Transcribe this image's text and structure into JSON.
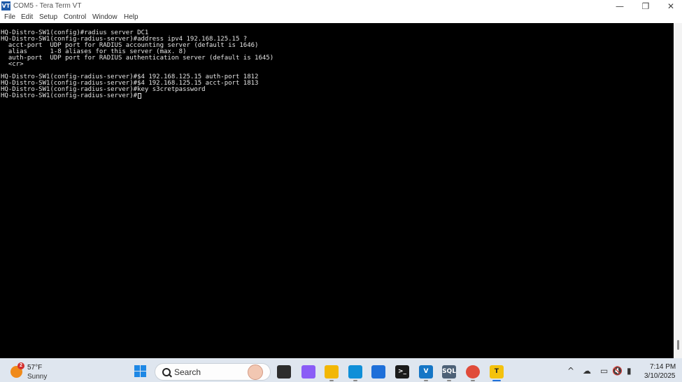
{
  "window": {
    "icon_label": "VT",
    "title": "COM5 - Tera Term VT",
    "minimize": "—",
    "restore": "❐",
    "close": "✕"
  },
  "menu": [
    "File",
    "Edit",
    "Setup",
    "Control",
    "Window",
    "Help"
  ],
  "terminal": {
    "lines": [
      "HQ-Distro-SW1(config)#radius server DC1",
      "HQ-Distro-SW1(config-radius-server)#address ipv4 192.168.125.15 ?",
      "  acct-port  UDP port for RADIUS accounting server (default is 1646)",
      "  alias      1-8 aliases for this server (max. 8)",
      "  auth-port  UDP port for RADIUS authentication server (default is 1645)",
      "  <cr>",
      "",
      "HQ-Distro-SW1(config-radius-server)#$4 192.168.125.15 auth-port 1812",
      "HQ-Distro-SW1(config-radius-server)#$4 192.168.125.15 acct-port 1813",
      "HQ-Distro-SW1(config-radius-server)#key s3cretpassword",
      "HQ-Distro-SW1(config-radius-server)#"
    ]
  },
  "taskbar": {
    "weather": {
      "badge": "2",
      "temp": "57°F",
      "condition": "Sunny"
    },
    "search_label": "Search",
    "apps": [
      {
        "name": "task-view-icon",
        "glyph": "",
        "color": "#2d2d2d"
      },
      {
        "name": "copilot-icon",
        "glyph": "",
        "color": "#8a5cf6"
      },
      {
        "name": "file-explorer-icon",
        "glyph": "",
        "color": "#f2b705"
      },
      {
        "name": "edge-icon",
        "glyph": "",
        "color": "#0f8fd8"
      },
      {
        "name": "microsoft-store-icon",
        "glyph": "",
        "color": "#1e6fd9"
      },
      {
        "name": "terminal-icon",
        "glyph": ">_",
        "color": "#1b1b1b"
      },
      {
        "name": "visual-studio-code-icon",
        "glyph": "V",
        "color": "#1576c6"
      },
      {
        "name": "ssms-icon",
        "glyph": "SQL",
        "color": "#4d6177"
      },
      {
        "name": "chrome-icon",
        "glyph": "",
        "color": "#e04b3a"
      },
      {
        "name": "teraterm-icon",
        "glyph": "T",
        "color": "#f4c20d"
      }
    ],
    "tray": {
      "chevron": "^",
      "onedrive": "☁",
      "network": "▭",
      "volume": "🔇",
      "battery": "▮"
    },
    "clock": {
      "time": "7:14 PM",
      "date": "3/10/2025"
    }
  }
}
